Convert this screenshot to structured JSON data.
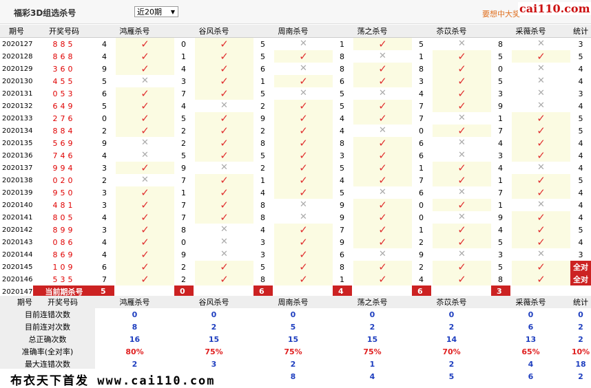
{
  "header": {
    "title": "福彩3D组选杀号",
    "period_select": "近20期",
    "banner_text": "要想中大奖",
    "logo": "cai110.com"
  },
  "columns": {
    "qihao": "期号",
    "kaijiang": "开奖号码",
    "experts": [
      "鸿雁杀号",
      "谷风杀号",
      "周南杀号",
      "荡之杀号",
      "苶苡杀号",
      "采薇杀号"
    ],
    "tongji": "统计"
  },
  "rows": [
    {
      "qi": "2020127",
      "num": "885",
      "picks": [
        {
          "k": "4",
          "ok": true
        },
        {
          "k": "0",
          "ok": true
        },
        {
          "k": "5",
          "ok": false
        },
        {
          "k": "1",
          "ok": true
        },
        {
          "k": "5",
          "ok": false
        },
        {
          "k": "8",
          "ok": false
        }
      ],
      "stat": "3"
    },
    {
      "qi": "2020128",
      "num": "868",
      "picks": [
        {
          "k": "4",
          "ok": true
        },
        {
          "k": "1",
          "ok": true
        },
        {
          "k": "5",
          "ok": true
        },
        {
          "k": "8",
          "ok": false
        },
        {
          "k": "1",
          "ok": true
        },
        {
          "k": "5",
          "ok": true
        }
      ],
      "stat": "5"
    },
    {
      "qi": "2020129",
      "num": "360",
      "picks": [
        {
          "k": "9",
          "ok": true
        },
        {
          "k": "4",
          "ok": true
        },
        {
          "k": "6",
          "ok": false
        },
        {
          "k": "8",
          "ok": true
        },
        {
          "k": "8",
          "ok": true
        },
        {
          "k": "0",
          "ok": false
        }
      ],
      "stat": "4"
    },
    {
      "qi": "2020130",
      "num": "455",
      "picks": [
        {
          "k": "5",
          "ok": false
        },
        {
          "k": "3",
          "ok": true
        },
        {
          "k": "1",
          "ok": true
        },
        {
          "k": "6",
          "ok": true
        },
        {
          "k": "3",
          "ok": true
        },
        {
          "k": "5",
          "ok": false
        }
      ],
      "stat": "4"
    },
    {
      "qi": "2020131",
      "num": "053",
      "picks": [
        {
          "k": "6",
          "ok": true
        },
        {
          "k": "7",
          "ok": true
        },
        {
          "k": "5",
          "ok": false
        },
        {
          "k": "5",
          "ok": false
        },
        {
          "k": "4",
          "ok": true
        },
        {
          "k": "3",
          "ok": false
        }
      ],
      "stat": "3"
    },
    {
      "qi": "2020132",
      "num": "649",
      "picks": [
        {
          "k": "5",
          "ok": true
        },
        {
          "k": "4",
          "ok": false
        },
        {
          "k": "2",
          "ok": true
        },
        {
          "k": "5",
          "ok": true
        },
        {
          "k": "7",
          "ok": true
        },
        {
          "k": "9",
          "ok": false
        }
      ],
      "stat": "4"
    },
    {
      "qi": "2020133",
      "num": "276",
      "picks": [
        {
          "k": "0",
          "ok": true
        },
        {
          "k": "5",
          "ok": true
        },
        {
          "k": "9",
          "ok": true
        },
        {
          "k": "4",
          "ok": true
        },
        {
          "k": "7",
          "ok": false
        },
        {
          "k": "1",
          "ok": true
        }
      ],
      "stat": "5"
    },
    {
      "qi": "2020134",
      "num": "884",
      "picks": [
        {
          "k": "2",
          "ok": true
        },
        {
          "k": "2",
          "ok": true
        },
        {
          "k": "2",
          "ok": true
        },
        {
          "k": "4",
          "ok": false
        },
        {
          "k": "0",
          "ok": true
        },
        {
          "k": "7",
          "ok": true
        }
      ],
      "stat": "5"
    },
    {
      "qi": "2020135",
      "num": "569",
      "picks": [
        {
          "k": "9",
          "ok": false
        },
        {
          "k": "2",
          "ok": true
        },
        {
          "k": "8",
          "ok": true
        },
        {
          "k": "8",
          "ok": true
        },
        {
          "k": "6",
          "ok": false
        },
        {
          "k": "4",
          "ok": true
        }
      ],
      "stat": "4"
    },
    {
      "qi": "2020136",
      "num": "746",
      "picks": [
        {
          "k": "4",
          "ok": false
        },
        {
          "k": "5",
          "ok": true
        },
        {
          "k": "5",
          "ok": true
        },
        {
          "k": "3",
          "ok": true
        },
        {
          "k": "6",
          "ok": false
        },
        {
          "k": "3",
          "ok": true
        }
      ],
      "stat": "4"
    },
    {
      "qi": "2020137",
      "num": "994",
      "picks": [
        {
          "k": "3",
          "ok": true
        },
        {
          "k": "9",
          "ok": false
        },
        {
          "k": "2",
          "ok": true
        },
        {
          "k": "5",
          "ok": true
        },
        {
          "k": "1",
          "ok": true
        },
        {
          "k": "4",
          "ok": false
        }
      ],
      "stat": "4"
    },
    {
      "qi": "2020138",
      "num": "020",
      "picks": [
        {
          "k": "2",
          "ok": false
        },
        {
          "k": "7",
          "ok": true
        },
        {
          "k": "1",
          "ok": true
        },
        {
          "k": "4",
          "ok": true
        },
        {
          "k": "7",
          "ok": true
        },
        {
          "k": "1",
          "ok": true
        }
      ],
      "stat": "5"
    },
    {
      "qi": "2020139",
      "num": "950",
      "picks": [
        {
          "k": "3",
          "ok": true
        },
        {
          "k": "1",
          "ok": true
        },
        {
          "k": "4",
          "ok": true
        },
        {
          "k": "5",
          "ok": false
        },
        {
          "k": "6",
          "ok": false
        },
        {
          "k": "7",
          "ok": true
        }
      ],
      "stat": "4"
    },
    {
      "qi": "2020140",
      "num": "481",
      "picks": [
        {
          "k": "3",
          "ok": true
        },
        {
          "k": "7",
          "ok": true
        },
        {
          "k": "8",
          "ok": false
        },
        {
          "k": "9",
          "ok": true
        },
        {
          "k": "0",
          "ok": true
        },
        {
          "k": "1",
          "ok": false
        }
      ],
      "stat": "4"
    },
    {
      "qi": "2020141",
      "num": "805",
      "picks": [
        {
          "k": "4",
          "ok": true
        },
        {
          "k": "7",
          "ok": true
        },
        {
          "k": "8",
          "ok": false
        },
        {
          "k": "9",
          "ok": true
        },
        {
          "k": "0",
          "ok": false
        },
        {
          "k": "9",
          "ok": true
        }
      ],
      "stat": "4"
    },
    {
      "qi": "2020142",
      "num": "899",
      "picks": [
        {
          "k": "3",
          "ok": true
        },
        {
          "k": "8",
          "ok": false
        },
        {
          "k": "4",
          "ok": true
        },
        {
          "k": "7",
          "ok": true
        },
        {
          "k": "1",
          "ok": true
        },
        {
          "k": "4",
          "ok": true
        }
      ],
      "stat": "5"
    },
    {
      "qi": "2020143",
      "num": "086",
      "picks": [
        {
          "k": "4",
          "ok": true
        },
        {
          "k": "0",
          "ok": false
        },
        {
          "k": "3",
          "ok": true
        },
        {
          "k": "9",
          "ok": true
        },
        {
          "k": "2",
          "ok": true
        },
        {
          "k": "5",
          "ok": true
        }
      ],
      "stat": "4"
    },
    {
      "qi": "2020144",
      "num": "869",
      "picks": [
        {
          "k": "4",
          "ok": true
        },
        {
          "k": "9",
          "ok": false
        },
        {
          "k": "3",
          "ok": true
        },
        {
          "k": "6",
          "ok": false
        },
        {
          "k": "9",
          "ok": false
        },
        {
          "k": "3",
          "ok": false
        }
      ],
      "stat": "3"
    },
    {
      "qi": "2020145",
      "num": "109",
      "picks": [
        {
          "k": "6",
          "ok": true
        },
        {
          "k": "2",
          "ok": true
        },
        {
          "k": "5",
          "ok": true
        },
        {
          "k": "8",
          "ok": true
        },
        {
          "k": "2",
          "ok": true
        },
        {
          "k": "5",
          "ok": true
        }
      ],
      "stat": "全对",
      "all": true
    },
    {
      "qi": "2020146",
      "num": "535",
      "picks": [
        {
          "k": "7",
          "ok": true
        },
        {
          "k": "2",
          "ok": true
        },
        {
          "k": "8",
          "ok": true
        },
        {
          "k": "1",
          "ok": true
        },
        {
          "k": "4",
          "ok": true
        },
        {
          "k": "8",
          "ok": true
        }
      ],
      "stat": "全对",
      "all": true
    }
  ],
  "current": {
    "qi": "2020147",
    "label": "当前期杀号",
    "picks": [
      "5",
      "0",
      "6",
      "4",
      "6",
      "3"
    ]
  },
  "stats": {
    "header": {
      "qihao": "期号",
      "kaijiang": "开奖号码",
      "tongji": "统计"
    },
    "rows": [
      {
        "label": "目前连错次数",
        "values": [
          "0",
          "0",
          "0",
          "0",
          "0",
          "0"
        ],
        "total": "0",
        "red": false
      },
      {
        "label": "目前连对次数",
        "values": [
          "8",
          "2",
          "5",
          "2",
          "2",
          "6"
        ],
        "total": "2",
        "red": false
      },
      {
        "label": "总正确次数",
        "values": [
          "16",
          "15",
          "15",
          "15",
          "14",
          "13"
        ],
        "total": "2",
        "red": false
      },
      {
        "label": "准确率(全对率)",
        "values": [
          "80%",
          "75%",
          "75%",
          "75%",
          "70%",
          "65%"
        ],
        "total": "10%",
        "red": true
      },
      {
        "label": "最大连错次数",
        "values": [
          "2",
          "3",
          "2",
          "1",
          "2",
          "4"
        ],
        "total": "18",
        "red": false
      },
      {
        "label": "",
        "values": [
          "",
          "",
          "8",
          "4",
          "5",
          "6"
        ],
        "total": "2",
        "red": false
      }
    ]
  },
  "footer": {
    "text": "布衣天下首发 www.cai110.com"
  }
}
